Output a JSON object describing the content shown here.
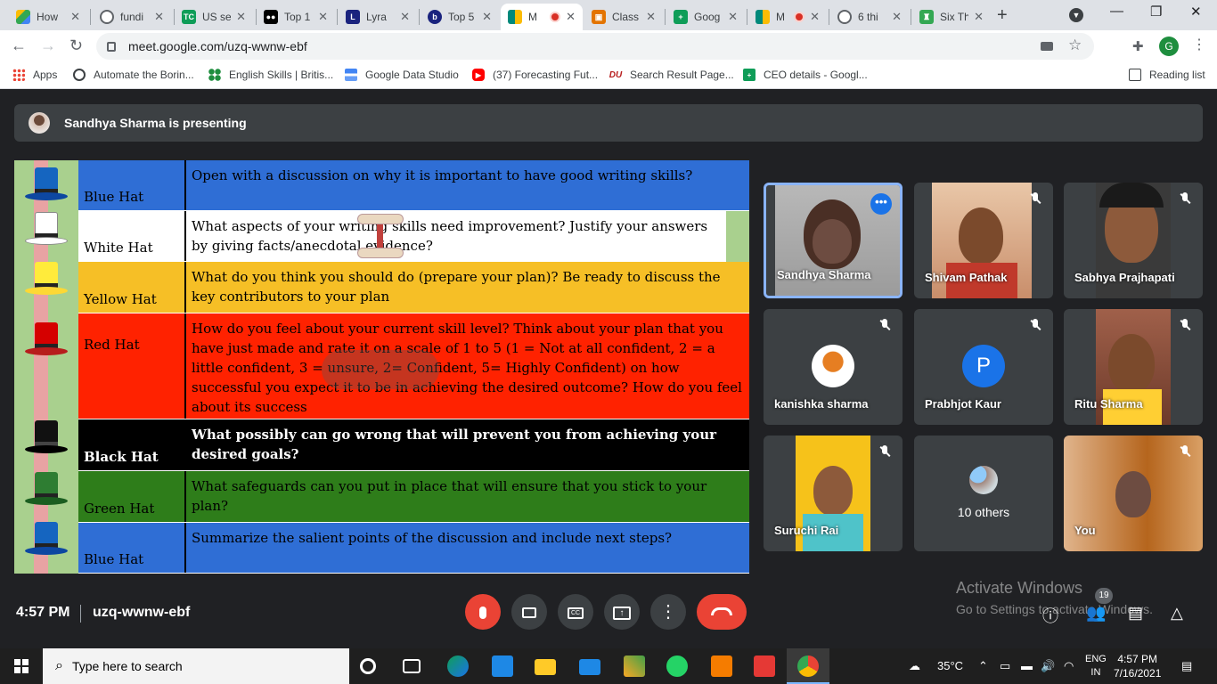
{
  "browser": {
    "tabs": [
      {
        "label": "How",
        "favicon": "google-drive-icon",
        "color": "#fbbc04"
      },
      {
        "label": "fundi",
        "favicon": "globe-icon",
        "color": "#5f6368"
      },
      {
        "label": "US se",
        "favicon": "tc-icon",
        "color": "#0f9d58"
      },
      {
        "label": "Top 1",
        "favicon": "medium-icon",
        "color": "#000000"
      },
      {
        "label": "Lyra",
        "favicon": "lyra-icon",
        "color": "#1a237e"
      },
      {
        "label": "Top 5",
        "favicon": "b-icon",
        "color": "#1a237e"
      },
      {
        "label": "M",
        "favicon": "google-meet-icon",
        "color": "#00897b"
      },
      {
        "label": "Class",
        "favicon": "classroom-icon",
        "color": "#e37400"
      },
      {
        "label": "Goog",
        "favicon": "google-sheets-icon",
        "color": "#0f9d58"
      },
      {
        "label": "M",
        "favicon": "google-meet-icon",
        "color": "#00897b"
      },
      {
        "label": "6 thi",
        "favicon": "globe-icon",
        "color": "#5f6368"
      },
      {
        "label": "Six Th",
        "favicon": "six-hats-icon",
        "color": "#34a853"
      }
    ],
    "url": "meet.google.com/uzq-wwnw-ebf",
    "profile_initial": "G",
    "bookmarks": [
      {
        "label": "Apps",
        "icon": "apps-grid-icon"
      },
      {
        "label": "Automate the Borin...",
        "icon": "globe-icon"
      },
      {
        "label": "English Skills | Britis...",
        "icon": "british-council-icon"
      },
      {
        "label": "Google Data Studio",
        "icon": "data-studio-icon"
      },
      {
        "label": "(37) Forecasting Fut...",
        "icon": "youtube-icon"
      },
      {
        "label": "Search Result Page...",
        "icon": "du-icon"
      },
      {
        "label": "CEO details - Googl...",
        "icon": "google-sheets-icon"
      }
    ],
    "reading_list": "Reading list"
  },
  "meet": {
    "presenting_text": "Sandhya Sharma is presenting",
    "slide_rows": [
      {
        "hat": "Blue Hat",
        "text": "Open with a discussion on why it is important to have good writing skills?",
        "bg": "#2f6ed5",
        "hat_color": "#1565c0"
      },
      {
        "hat": "White Hat",
        "text": "What aspects of your writing skills need improvement? Justify your answers by giving facts/anecdotal evidence?",
        "bg": "#ffffff",
        "hat_color": "#ffffff"
      },
      {
        "hat": "Yellow Hat",
        "text": "What do you think you should do (prepare your plan)? Be ready to discuss the key contributors to your plan",
        "bg": "#f6bf26",
        "hat_color": "#ffeb3b"
      },
      {
        "hat": "Red Hat",
        "text": "How do you feel about your current skill level? Think about your plan that you have just made and rate it on a scale of 1 to 5 (1 = Not at all confident, 2 = a little confident, 3 = unsure, 2= Confident, 5= Highly Confident) on how successful you expect it to be in achieving the desired outcome? How do you feel about its success",
        "bg": "#ff2200",
        "hat_color": "#d50000"
      },
      {
        "hat": "Black Hat",
        "text": "What possibly can go wrong that will prevent you from achieving your desired goals?",
        "bg": "#000000",
        "hat_color": "#111111"
      },
      {
        "hat": "Green Hat",
        "text": "What safeguards can you put in place that will ensure that you stick to your plan?",
        "bg": "#2e7d1a",
        "hat_color": "#2e7d32"
      },
      {
        "hat": "Blue Hat",
        "text": "Summarize the salient points of the discussion and include next steps?",
        "bg": "#2f6ed5",
        "hat_color": "#1565c0"
      }
    ],
    "participants": [
      {
        "name": "Sandhya Sharma",
        "muted": false,
        "speaking": true
      },
      {
        "name": "Shivam Pathak",
        "muted": true
      },
      {
        "name": "Sabhya Prajhapati",
        "muted": true
      },
      {
        "name": "kanishka sharma",
        "muted": true
      },
      {
        "name": "Prabhjot Kaur",
        "muted": true,
        "initial": "P"
      },
      {
        "name": "Ritu Sharma",
        "muted": true
      },
      {
        "name": "Suruchi Rai",
        "muted": true
      },
      {
        "name": "10 others"
      },
      {
        "name": "You",
        "muted": true
      }
    ],
    "time": "4:57 PM",
    "meeting_code": "uzq-wwnw-ebf",
    "participant_count": "19",
    "activate_title": "Activate Windows",
    "activate_sub": "Go to Settings to activate Windows."
  },
  "taskbar": {
    "search_placeholder": "Type here to search",
    "temperature": "35°C",
    "lang_top": "ENG",
    "lang_bottom": "IN",
    "clock_time": "4:57 PM",
    "clock_date": "7/16/2021"
  }
}
